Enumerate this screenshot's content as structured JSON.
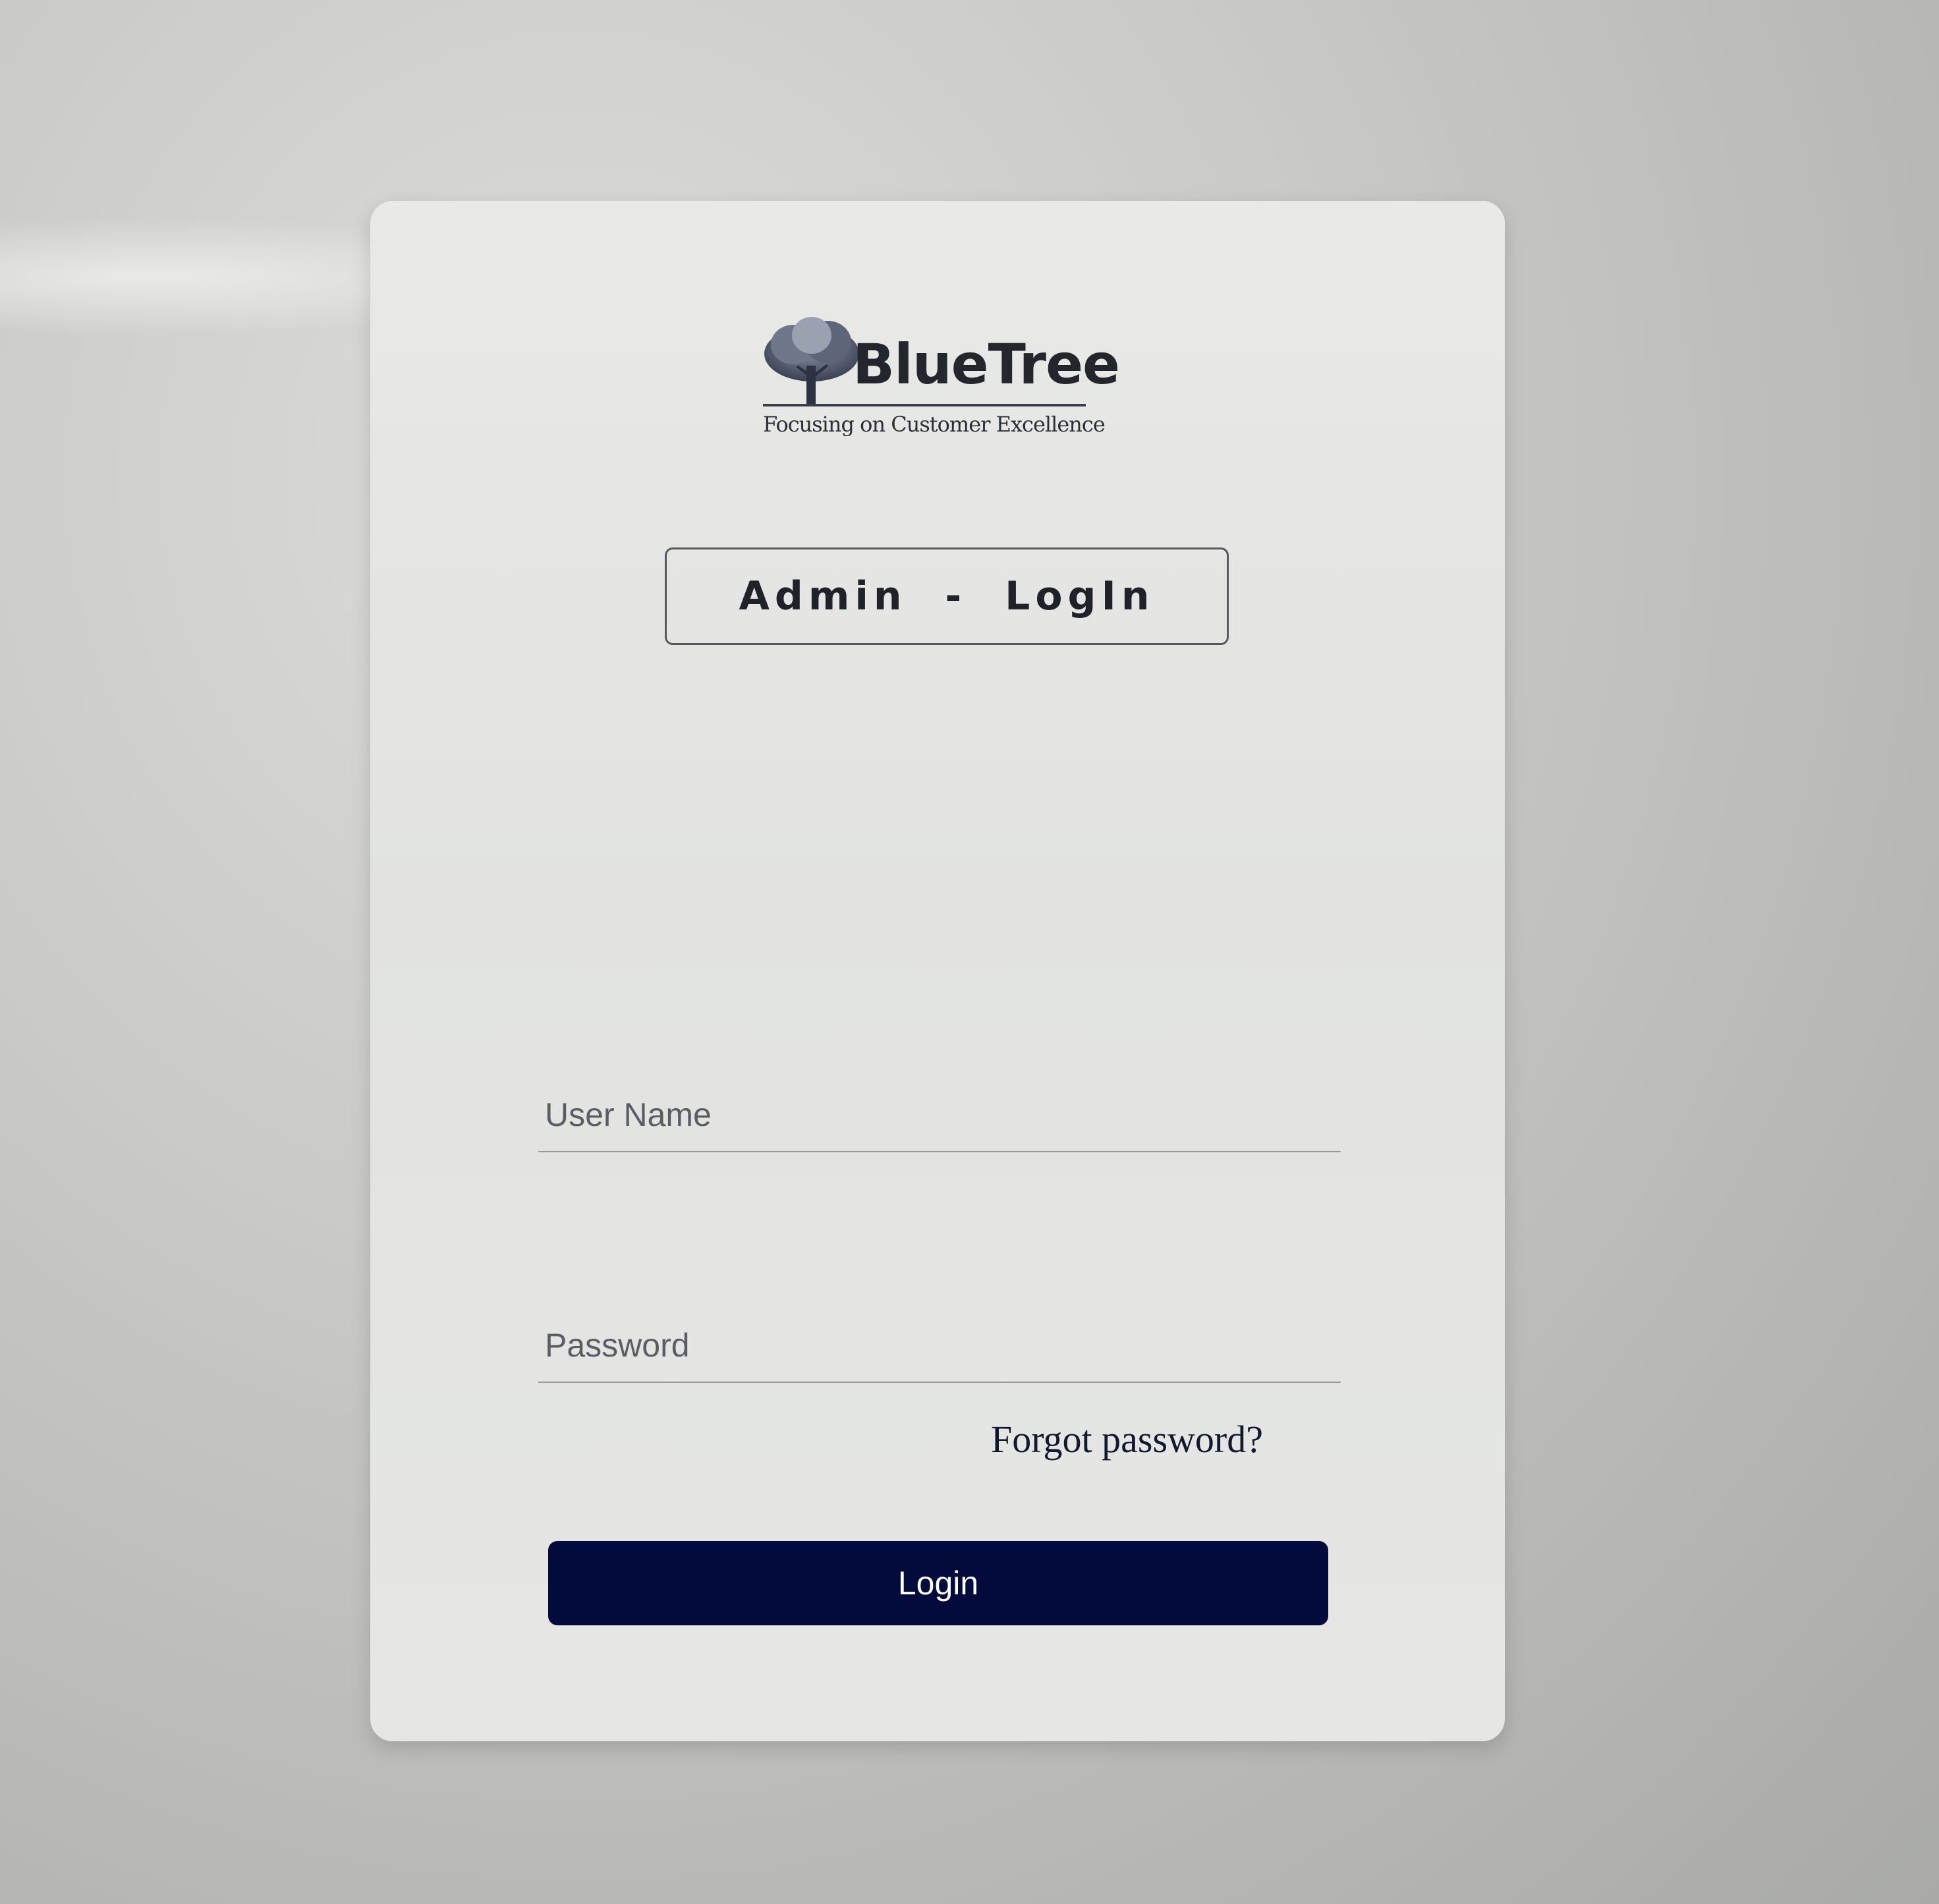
{
  "brand": {
    "name": "BlueTree",
    "tagline": "Focusing on Customer Excellence",
    "logo_icon": "tree-icon"
  },
  "header": {
    "title": "Admin  -  LogIn"
  },
  "form": {
    "username_placeholder": "User Name",
    "username_value": "",
    "password_placeholder": "Password",
    "password_value": "",
    "forgot_label": "Forgot password?",
    "login_label": "Login"
  },
  "colors": {
    "button_bg": "#020b3b",
    "button_text": "#ffffff",
    "card_bg": "#e6e7e5"
  }
}
